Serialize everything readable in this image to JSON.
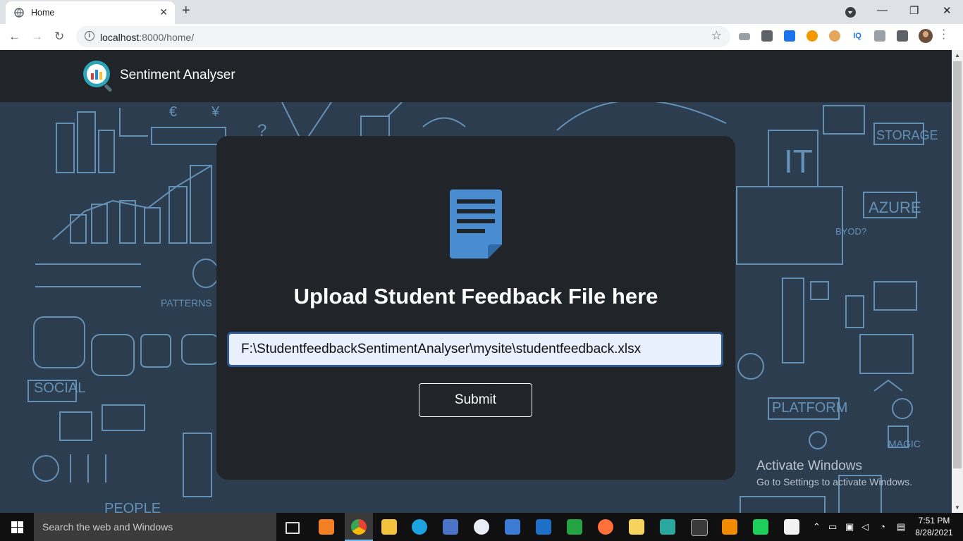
{
  "browser": {
    "tab_title": "Home",
    "tab_close": "✕",
    "new_tab": "+",
    "url_host": "localhost",
    "url_rest": ":8000/home/",
    "window_minimize": "—",
    "window_restore": "❐",
    "window_close": "✕",
    "back": "←",
    "forward": "→",
    "reload": "↻",
    "star": "☆",
    "info_icon": "i",
    "extensions": [
      "speed-icon",
      "cast-icon",
      "grid-icon",
      "moon-icon",
      "cookie-icon",
      "iq-icon",
      "camera-icon",
      "puzzle-icon"
    ],
    "ext_iq_label": "IQ"
  },
  "app": {
    "brand_name": "Sentiment Analyser"
  },
  "upload": {
    "title": "Upload Student Feedback File here",
    "file_value": "F:\\StudentfeedbackSentimentAnalyser\\mysite\\studentfeedback.xlsx",
    "submit_label": "Submit"
  },
  "watermark": {
    "line1": "Activate Windows",
    "line2": "Go to Settings to activate Windows."
  },
  "taskbar": {
    "search_placeholder": "Search the web and Windows",
    "time": "7:51 PM",
    "date": "8/28/2021"
  },
  "colors": {
    "accent": "#4a90d9",
    "navbar": "#212529",
    "card": "#212529",
    "page_bg": "#2c3d4f"
  }
}
